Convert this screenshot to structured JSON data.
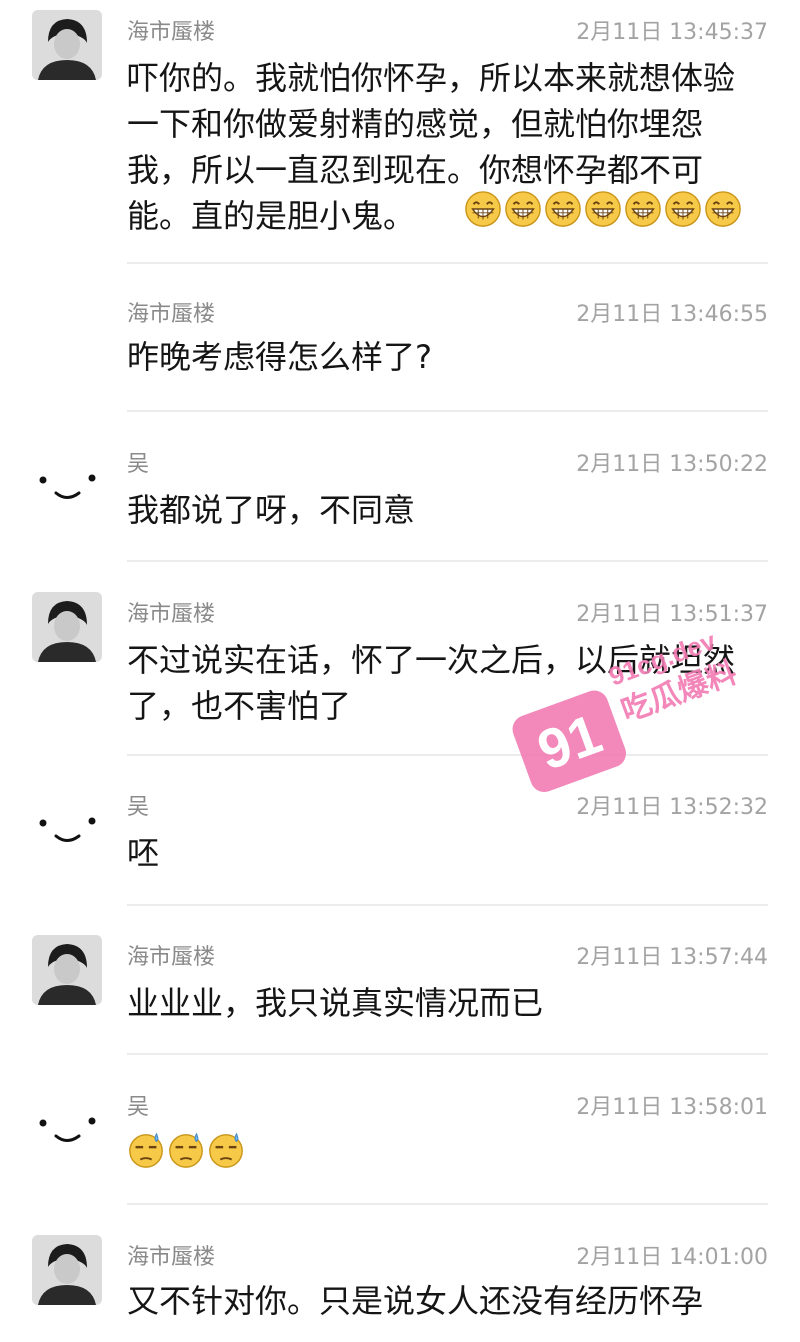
{
  "messages": [
    {
      "name": "海市蜃楼",
      "time": "2月11日 13:45:37",
      "text": "吓你的。我就怕你怀孕，所以本来就想体验一下和你做爱射精的感觉，但就怕你埋怨我，所以一直忍到现在。你想怀孕都不可能。直的是胆小鬼。",
      "emoji": "grin-emoji",
      "emoji_count": 7,
      "avatar": "photo-avatar"
    },
    {
      "name": "海市蜃楼",
      "time": "2月11日 13:46:55",
      "text": "昨晚考虑得怎么样了?",
      "avatar": "none"
    },
    {
      "name": "吴",
      "time": "2月11日 13:50:22",
      "text": "我都说了呀，不同意",
      "avatar": "smiley-avatar"
    },
    {
      "name": "海市蜃楼",
      "time": "2月11日 13:51:37",
      "text": "不过说实在话，怀了一次之后，以后就坦然了，也不害怕了",
      "avatar": "photo-avatar"
    },
    {
      "name": "吴",
      "time": "2月11日 13:52:32",
      "text": "呸",
      "avatar": "smiley-avatar"
    },
    {
      "name": "海市蜃楼",
      "time": "2月11日 13:57:44",
      "text": "业业业，我只说真实情况而已",
      "avatar": "photo-avatar"
    },
    {
      "name": "吴",
      "time": "2月11日 13:58:01",
      "emoji": "sweat-emoji",
      "emoji_count": 3,
      "avatar": "smiley-avatar"
    },
    {
      "name": "海市蜃楼",
      "time": "2月11日 14:01:00",
      "text": "又不针对你。只是说女人还没有经历怀孕",
      "avatar": "photo-avatar"
    }
  ],
  "watermark": {
    "number": "91",
    "domain": "91cg.dev",
    "label": "吃瓜爆料",
    "color": "#f27bb3"
  }
}
